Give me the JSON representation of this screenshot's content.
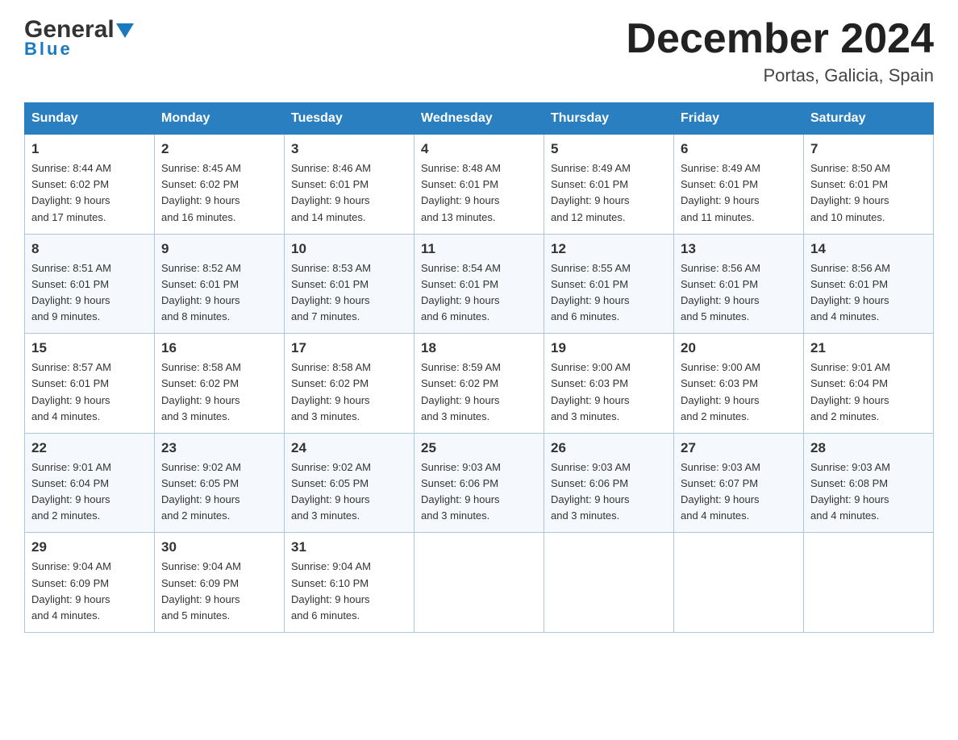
{
  "header": {
    "logo_general": "General",
    "logo_blue": "Blue",
    "month_title": "December 2024",
    "subtitle": "Portas, Galicia, Spain"
  },
  "weekdays": [
    "Sunday",
    "Monday",
    "Tuesday",
    "Wednesday",
    "Thursday",
    "Friday",
    "Saturday"
  ],
  "weeks": [
    [
      {
        "day": "1",
        "sunrise": "8:44 AM",
        "sunset": "6:02 PM",
        "daylight": "9 hours and 17 minutes."
      },
      {
        "day": "2",
        "sunrise": "8:45 AM",
        "sunset": "6:02 PM",
        "daylight": "9 hours and 16 minutes."
      },
      {
        "day": "3",
        "sunrise": "8:46 AM",
        "sunset": "6:01 PM",
        "daylight": "9 hours and 14 minutes."
      },
      {
        "day": "4",
        "sunrise": "8:48 AM",
        "sunset": "6:01 PM",
        "daylight": "9 hours and 13 minutes."
      },
      {
        "day": "5",
        "sunrise": "8:49 AM",
        "sunset": "6:01 PM",
        "daylight": "9 hours and 12 minutes."
      },
      {
        "day": "6",
        "sunrise": "8:49 AM",
        "sunset": "6:01 PM",
        "daylight": "9 hours and 11 minutes."
      },
      {
        "day": "7",
        "sunrise": "8:50 AM",
        "sunset": "6:01 PM",
        "daylight": "9 hours and 10 minutes."
      }
    ],
    [
      {
        "day": "8",
        "sunrise": "8:51 AM",
        "sunset": "6:01 PM",
        "daylight": "9 hours and 9 minutes."
      },
      {
        "day": "9",
        "sunrise": "8:52 AM",
        "sunset": "6:01 PM",
        "daylight": "9 hours and 8 minutes."
      },
      {
        "day": "10",
        "sunrise": "8:53 AM",
        "sunset": "6:01 PM",
        "daylight": "9 hours and 7 minutes."
      },
      {
        "day": "11",
        "sunrise": "8:54 AM",
        "sunset": "6:01 PM",
        "daylight": "9 hours and 6 minutes."
      },
      {
        "day": "12",
        "sunrise": "8:55 AM",
        "sunset": "6:01 PM",
        "daylight": "9 hours and 6 minutes."
      },
      {
        "day": "13",
        "sunrise": "8:56 AM",
        "sunset": "6:01 PM",
        "daylight": "9 hours and 5 minutes."
      },
      {
        "day": "14",
        "sunrise": "8:56 AM",
        "sunset": "6:01 PM",
        "daylight": "9 hours and 4 minutes."
      }
    ],
    [
      {
        "day": "15",
        "sunrise": "8:57 AM",
        "sunset": "6:01 PM",
        "daylight": "9 hours and 4 minutes."
      },
      {
        "day": "16",
        "sunrise": "8:58 AM",
        "sunset": "6:02 PM",
        "daylight": "9 hours and 3 minutes."
      },
      {
        "day": "17",
        "sunrise": "8:58 AM",
        "sunset": "6:02 PM",
        "daylight": "9 hours and 3 minutes."
      },
      {
        "day": "18",
        "sunrise": "8:59 AM",
        "sunset": "6:02 PM",
        "daylight": "9 hours and 3 minutes."
      },
      {
        "day": "19",
        "sunrise": "9:00 AM",
        "sunset": "6:03 PM",
        "daylight": "9 hours and 3 minutes."
      },
      {
        "day": "20",
        "sunrise": "9:00 AM",
        "sunset": "6:03 PM",
        "daylight": "9 hours and 2 minutes."
      },
      {
        "day": "21",
        "sunrise": "9:01 AM",
        "sunset": "6:04 PM",
        "daylight": "9 hours and 2 minutes."
      }
    ],
    [
      {
        "day": "22",
        "sunrise": "9:01 AM",
        "sunset": "6:04 PM",
        "daylight": "9 hours and 2 minutes."
      },
      {
        "day": "23",
        "sunrise": "9:02 AM",
        "sunset": "6:05 PM",
        "daylight": "9 hours and 2 minutes."
      },
      {
        "day": "24",
        "sunrise": "9:02 AM",
        "sunset": "6:05 PM",
        "daylight": "9 hours and 3 minutes."
      },
      {
        "day": "25",
        "sunrise": "9:03 AM",
        "sunset": "6:06 PM",
        "daylight": "9 hours and 3 minutes."
      },
      {
        "day": "26",
        "sunrise": "9:03 AM",
        "sunset": "6:06 PM",
        "daylight": "9 hours and 3 minutes."
      },
      {
        "day": "27",
        "sunrise": "9:03 AM",
        "sunset": "6:07 PM",
        "daylight": "9 hours and 4 minutes."
      },
      {
        "day": "28",
        "sunrise": "9:03 AM",
        "sunset": "6:08 PM",
        "daylight": "9 hours and 4 minutes."
      }
    ],
    [
      {
        "day": "29",
        "sunrise": "9:04 AM",
        "sunset": "6:09 PM",
        "daylight": "9 hours and 4 minutes."
      },
      {
        "day": "30",
        "sunrise": "9:04 AM",
        "sunset": "6:09 PM",
        "daylight": "9 hours and 5 minutes."
      },
      {
        "day": "31",
        "sunrise": "9:04 AM",
        "sunset": "6:10 PM",
        "daylight": "9 hours and 6 minutes."
      },
      null,
      null,
      null,
      null
    ]
  ],
  "labels": {
    "sunrise": "Sunrise:",
    "sunset": "Sunset:",
    "daylight": "Daylight:"
  }
}
